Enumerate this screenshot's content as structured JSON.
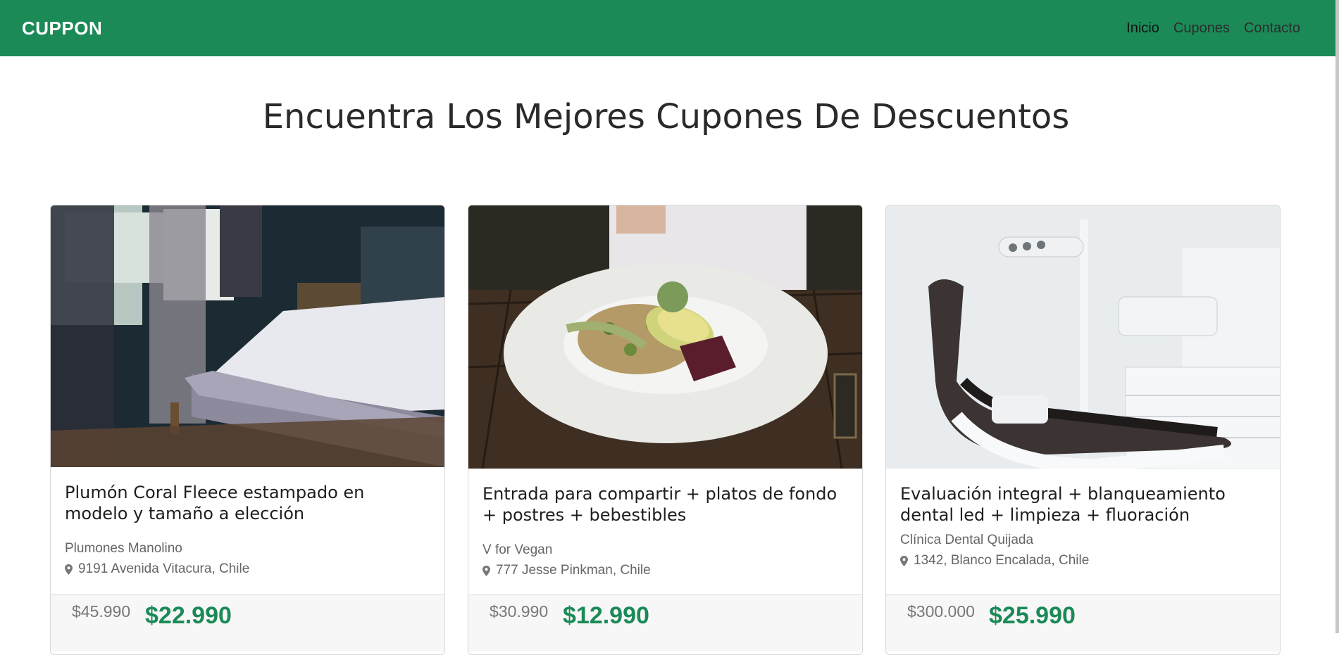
{
  "nav": {
    "brand": "CUPPON",
    "links": [
      {
        "label": "Inicio"
      },
      {
        "label": "Cupones"
      },
      {
        "label": "Contacto"
      }
    ]
  },
  "page_title": "Encuentra Los Mejores Cupones De Descuentos",
  "coupons": [
    {
      "title": "Plumón Coral Fleece estampado en modelo y tamaño a elección",
      "merchant": "Plumones Manolino",
      "address": "9191 Avenida Vitacura, Chile",
      "old_price": "$45.990",
      "new_price": "$22.990",
      "image": "bedroom-photo"
    },
    {
      "title": "Entrada para compartir + platos de fondo + postres + bebestibles",
      "merchant": "V for Vegan",
      "address": "777 Jesse Pinkman, Chile",
      "old_price": "$30.990",
      "new_price": "$12.990",
      "image": "vegan-dish-photo"
    },
    {
      "title": "Evaluación integral + blanqueamiento dental led + limpieza + fluoración",
      "merchant": "Clínica Dental Quijada",
      "address": "1342, Blanco Encalada, Chile",
      "old_price": "$300.000",
      "new_price": "$25.990",
      "image": "dental-office-photo"
    }
  ],
  "colors": {
    "brand": "#1b8a57"
  },
  "icons": {
    "location": "map-pin-icon"
  }
}
